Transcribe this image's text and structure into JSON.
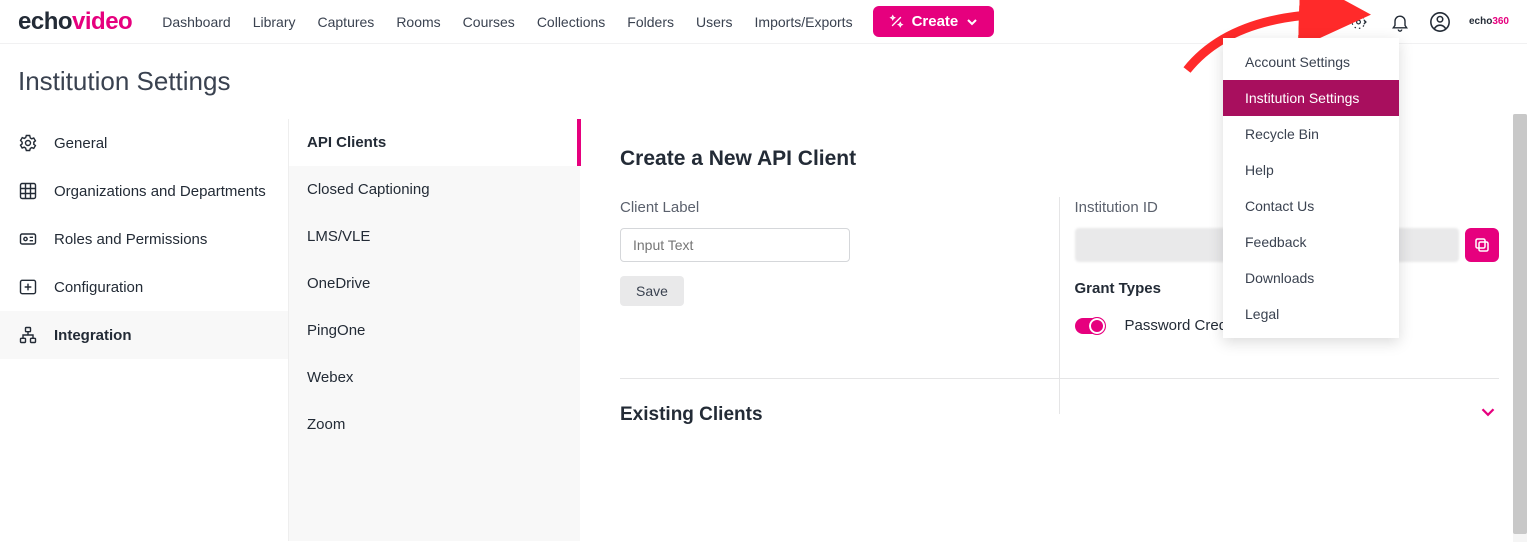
{
  "logo": {
    "a": "echo",
    "b": "video"
  },
  "mini_logo": {
    "a": "echo",
    "b": "360"
  },
  "nav": [
    "Dashboard",
    "Library",
    "Captures",
    "Rooms",
    "Courses",
    "Collections",
    "Folders",
    "Users",
    "Imports/Exports"
  ],
  "create_label": "Create",
  "page_title": "Institution Settings",
  "sidebar1": [
    {
      "icon": "gear",
      "label": "General"
    },
    {
      "icon": "org",
      "label": "Organizations and Departments"
    },
    {
      "icon": "role",
      "label": "Roles and Permissions"
    },
    {
      "icon": "config",
      "label": "Configuration"
    },
    {
      "icon": "integration",
      "label": "Integration",
      "active": true
    }
  ],
  "sidebar2": [
    {
      "label": "API Clients",
      "active": true
    },
    {
      "label": "Closed Captioning"
    },
    {
      "label": "LMS/VLE"
    },
    {
      "label": "OneDrive"
    },
    {
      "label": "PingOne"
    },
    {
      "label": "Webex"
    },
    {
      "label": "Zoom"
    }
  ],
  "main": {
    "create_title": "Create a New API Client",
    "client_label": "Client Label",
    "client_placeholder": "Input Text",
    "institution_id": "Institution ID",
    "save": "Save",
    "grant_types": "Grant Types",
    "toggle1": "Password Credentials",
    "toggle2": "",
    "existing": "Existing Clients"
  },
  "dropdown": [
    {
      "label": "Account Settings"
    },
    {
      "label": "Institution Settings",
      "active": true
    },
    {
      "label": "Recycle Bin"
    },
    {
      "label": "Help"
    },
    {
      "label": "Contact Us"
    },
    {
      "label": "Feedback"
    },
    {
      "label": "Downloads"
    },
    {
      "label": "Legal"
    }
  ]
}
